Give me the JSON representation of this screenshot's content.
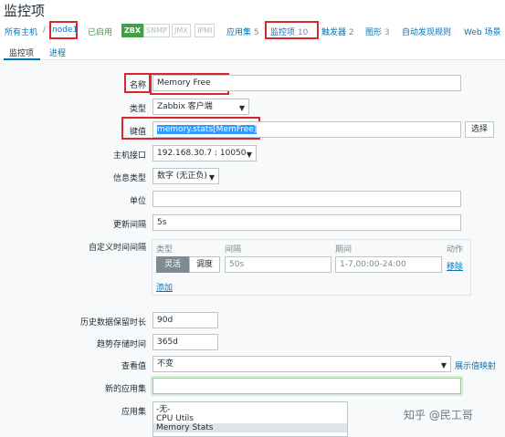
{
  "page": {
    "title": "监控项"
  },
  "breadcrumb": {
    "all_hosts": "所有主机",
    "separator": "/",
    "host": "node1",
    "status": "已启用"
  },
  "availability": [
    "ZBX",
    "SNMP",
    "JMX",
    "IPMI"
  ],
  "nav": {
    "applications": {
      "label": "应用集",
      "count": "5"
    },
    "items": {
      "label": "监控项",
      "count": "10"
    },
    "triggers": {
      "label": "触发器",
      "count": "2"
    },
    "graphs": {
      "label": "图形",
      "count": "3"
    },
    "discovery": {
      "label": "自动发现规则"
    },
    "web": {
      "label": "Web 场景"
    }
  },
  "tabs": {
    "item": "监控项",
    "process": "进程"
  },
  "form": {
    "name": {
      "label": "名称",
      "value": "Memory Free"
    },
    "type": {
      "label": "类型",
      "value": "Zabbix 客户端"
    },
    "key": {
      "label": "键值",
      "value": "memory.stats[MemFree]",
      "select_button": "选择"
    },
    "host_interface": {
      "label": "主机接口",
      "value": "192.168.30.7 : 10050"
    },
    "info_type": {
      "label": "信息类型",
      "value": "数字 (无正负)"
    },
    "units": {
      "label": "单位",
      "value": ""
    },
    "update_interval": {
      "label": "更新间隔",
      "value": "5s"
    },
    "custom_intervals": {
      "label": "自定义时间间隔",
      "col_type": "类型",
      "col_interval": "间隔",
      "col_period": "期间",
      "col_action": "动作",
      "seg_flexible": "灵活",
      "seg_scheduling": "调度",
      "interval": "50s",
      "period": "1-7,00:00-24:00",
      "remove": "移除",
      "add": "添加"
    },
    "history": {
      "label": "历史数据保留时长",
      "value": "90d"
    },
    "trends": {
      "label": "趋势存储时间",
      "value": "365d"
    },
    "show_value": {
      "label": "查看值",
      "value": "不变",
      "mapping_link": "展示值映射"
    },
    "new_application": {
      "label": "新的应用集",
      "value": ""
    },
    "applications": {
      "label": "应用集",
      "options": [
        "-无-",
        "CPU Utils",
        "Memory Stats"
      ],
      "selected": "Memory Stats"
    }
  },
  "watermark": "知乎 @民工哥",
  "colors": {
    "link": "#0275b8",
    "highlight": "#d9272e",
    "green": "#429e47",
    "form_bg": "#f7f9fa"
  }
}
